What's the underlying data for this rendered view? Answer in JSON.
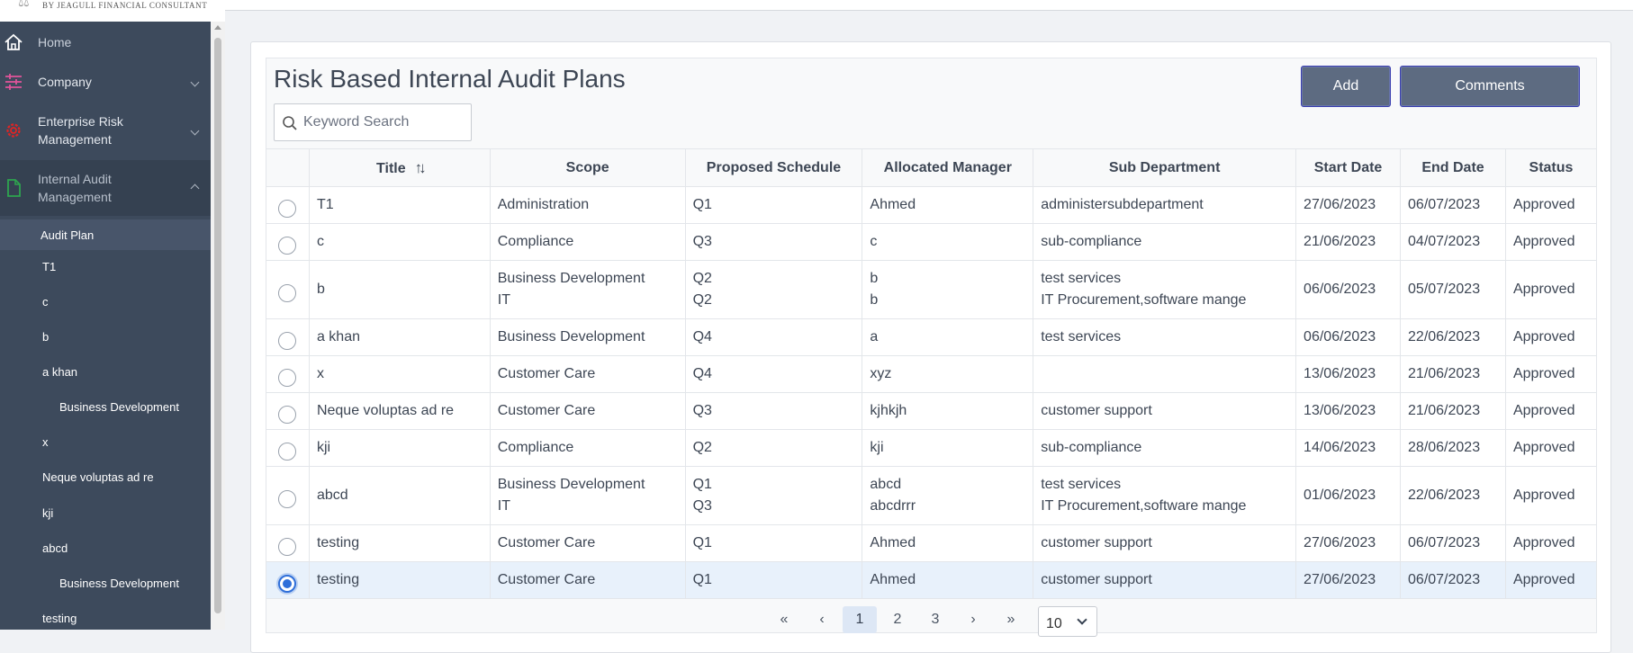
{
  "brand": {
    "tagline": "BY JEAGULL FINANCIAL CONSULTANT"
  },
  "sidebar": {
    "items": [
      {
        "label": "Home",
        "icon": "home-icon"
      },
      {
        "label": "Company",
        "icon": "sliders-icon"
      },
      {
        "label": "Enterprise Risk\nManagement",
        "icon": "gear-icon"
      },
      {
        "label": "Internal Audit\nManagement",
        "icon": "document-icon"
      }
    ],
    "sub_items": [
      "Audit Plan",
      "T1",
      "c",
      "b",
      "a khan",
      "Business Development",
      "x",
      "Neque voluptas ad re",
      "kji",
      "abcd",
      "Business Development",
      "testing"
    ]
  },
  "main": {
    "title": "Risk Based Internal Audit Plans",
    "search_placeholder": "Keyword Search",
    "add_label": "Add",
    "comments_label": "Comments"
  },
  "table": {
    "headers": [
      "Title",
      "Scope",
      "Proposed Schedule",
      "Allocated Manager",
      "Sub Department",
      "Start Date",
      "End Date",
      "Status"
    ],
    "rows": [
      {
        "title": "T1",
        "scope": [
          "Administration"
        ],
        "schedule": [
          "Q1"
        ],
        "manager": [
          "Ahmed"
        ],
        "subdept": [
          "administersubdepartment"
        ],
        "start": "27/06/2023",
        "end": "06/07/2023",
        "status": "Approved",
        "selected": false
      },
      {
        "title": "c",
        "scope": [
          "Compliance"
        ],
        "schedule": [
          "Q3"
        ],
        "manager": [
          "c"
        ],
        "subdept": [
          "sub-compliance"
        ],
        "start": "21/06/2023",
        "end": "04/07/2023",
        "status": "Approved",
        "selected": false
      },
      {
        "title": "b",
        "scope": [
          "Business Development",
          "IT"
        ],
        "schedule": [
          "Q2",
          "Q2"
        ],
        "manager": [
          "b",
          "b"
        ],
        "subdept": [
          "test services",
          "IT Procurement,software mange"
        ],
        "start": "06/06/2023",
        "end": "05/07/2023",
        "status": "Approved",
        "selected": false
      },
      {
        "title": "a khan",
        "scope": [
          "Business Development"
        ],
        "schedule": [
          "Q4"
        ],
        "manager": [
          "a"
        ],
        "subdept": [
          "test services"
        ],
        "start": "06/06/2023",
        "end": "22/06/2023",
        "status": "Approved",
        "selected": false
      },
      {
        "title": "x",
        "scope": [
          "Customer Care"
        ],
        "schedule": [
          "Q4"
        ],
        "manager": [
          "xyz"
        ],
        "subdept": [
          ""
        ],
        "start": "13/06/2023",
        "end": "21/06/2023",
        "status": "Approved",
        "selected": false
      },
      {
        "title": "Neque voluptas ad re",
        "scope": [
          "Customer Care"
        ],
        "schedule": [
          "Q3"
        ],
        "manager": [
          "kjhkjh"
        ],
        "subdept": [
          "customer support"
        ],
        "start": "13/06/2023",
        "end": "21/06/2023",
        "status": "Approved",
        "selected": false
      },
      {
        "title": "kji",
        "scope": [
          "Compliance"
        ],
        "schedule": [
          "Q2"
        ],
        "manager": [
          "kji"
        ],
        "subdept": [
          "sub-compliance"
        ],
        "start": "14/06/2023",
        "end": "28/06/2023",
        "status": "Approved",
        "selected": false
      },
      {
        "title": "abcd",
        "scope": [
          "Business Development",
          "IT"
        ],
        "schedule": [
          "Q1",
          "Q3"
        ],
        "manager": [
          "abcd",
          "abcdrrr"
        ],
        "subdept": [
          "test services",
          "IT Procurement,software mange"
        ],
        "start": "01/06/2023",
        "end": "22/06/2023",
        "status": "Approved",
        "selected": false
      },
      {
        "title": "testing",
        "scope": [
          "Customer Care"
        ],
        "schedule": [
          "Q1"
        ],
        "manager": [
          "Ahmed"
        ],
        "subdept": [
          "customer support"
        ],
        "start": "27/06/2023",
        "end": "06/07/2023",
        "status": "Approved",
        "selected": false
      },
      {
        "title": "testing",
        "scope": [
          "Customer Care"
        ],
        "schedule": [
          "Q1"
        ],
        "manager": [
          "Ahmed"
        ],
        "subdept": [
          "customer support"
        ],
        "start": "27/06/2023",
        "end": "06/07/2023",
        "status": "Approved",
        "selected": true
      }
    ]
  },
  "pagination": {
    "first": "«",
    "prev": "‹",
    "pages": [
      "1",
      "2",
      "3"
    ],
    "current": "1",
    "next": "›",
    "last": "»",
    "rows_per_page": "10"
  },
  "colors": {
    "sidebar_bg": "#3d4a5c",
    "accent": "#2f6fd9",
    "button_bg": "#5d6b81",
    "home_icon": "#ffffff",
    "company_icon": "#e0549a",
    "erm_icon": "#e02424",
    "iam_icon": "#2ea44f"
  }
}
